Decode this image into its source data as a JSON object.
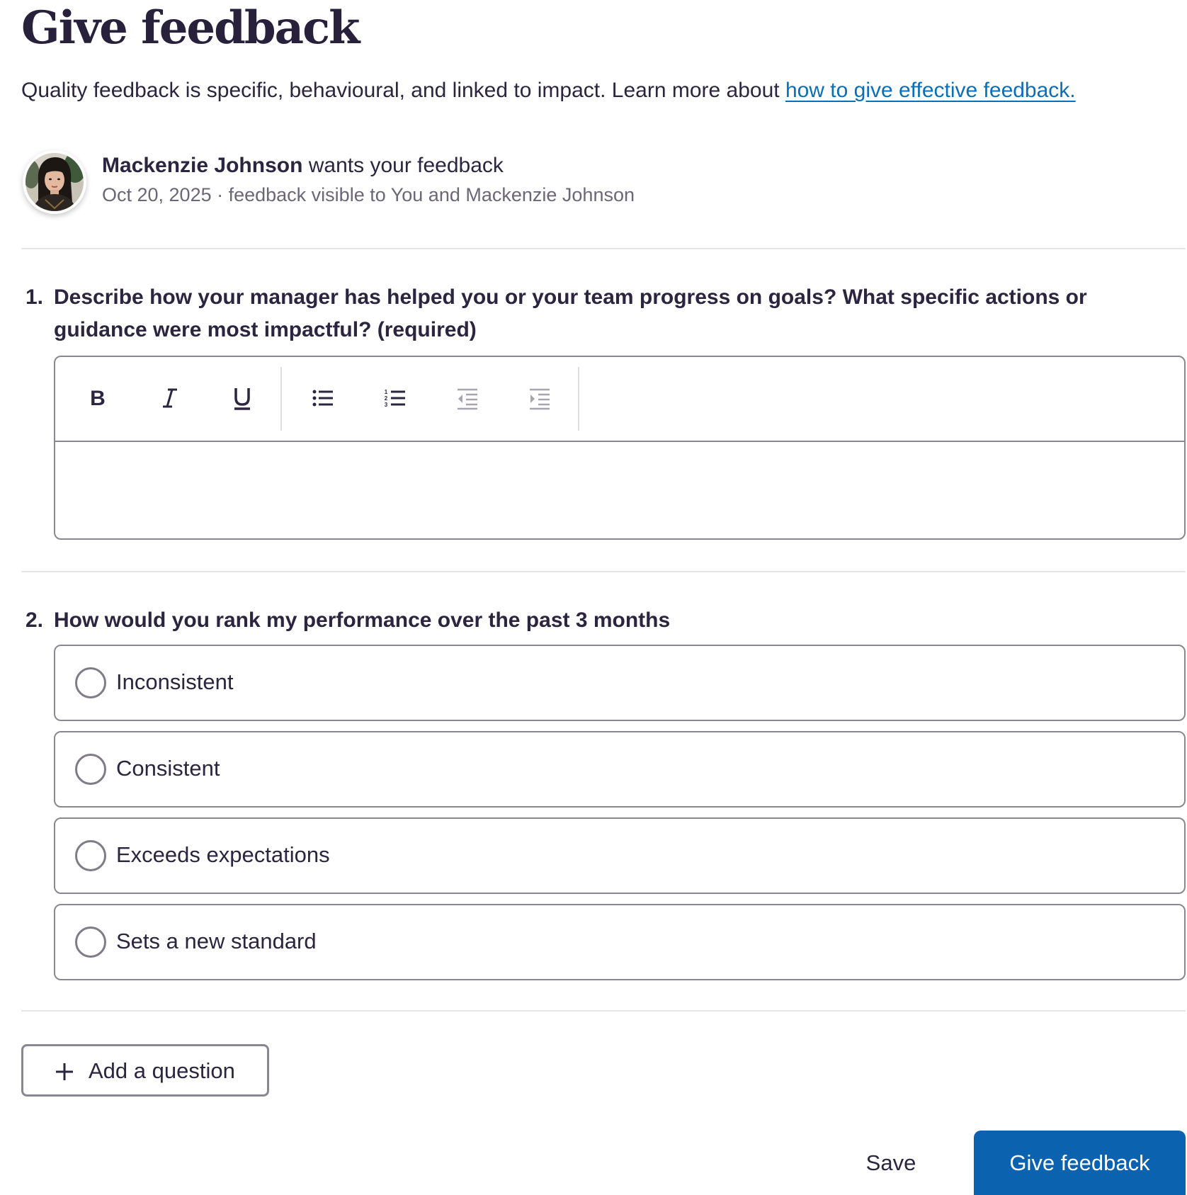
{
  "header": {
    "title": "Give feedback",
    "intro_text": "Quality feedback is specific, behavioural, and linked to impact. Learn more about ",
    "intro_link": "how to give effective feedback."
  },
  "requester": {
    "name": "Mackenzie Johnson",
    "action": " wants your feedback",
    "meta": "Oct 20, 2025 · feedback visible to You and Mackenzie Johnson"
  },
  "questions": [
    {
      "number": "1.",
      "text": "Describe how your manager has helped you or your team progress on goals? What specific actions or guidance were most impactful? (required)",
      "type": "rich-text",
      "value": ""
    },
    {
      "number": "2.",
      "text": "How would you rank my performance over the past 3 months",
      "type": "single-choice",
      "options": [
        "Inconsistent",
        "Consistent",
        "Exceeds expectations",
        "Sets a new standard"
      ],
      "selected": null
    }
  ],
  "toolbar": {
    "buttons": [
      "bold-icon",
      "italic-icon",
      "underline-icon",
      "bulleted-list-icon",
      "numbered-list-icon",
      "outdent-icon",
      "indent-icon"
    ]
  },
  "actions": {
    "add_question_label": "Add a question",
    "save_label": "Save",
    "submit_label": "Give feedback"
  },
  "colors": {
    "primary": "#0b63b0",
    "link": "#0b6fb8",
    "text": "#2b2540",
    "muted": "#6b6678",
    "border": "#8a8794",
    "divider": "#e6e4ea"
  }
}
